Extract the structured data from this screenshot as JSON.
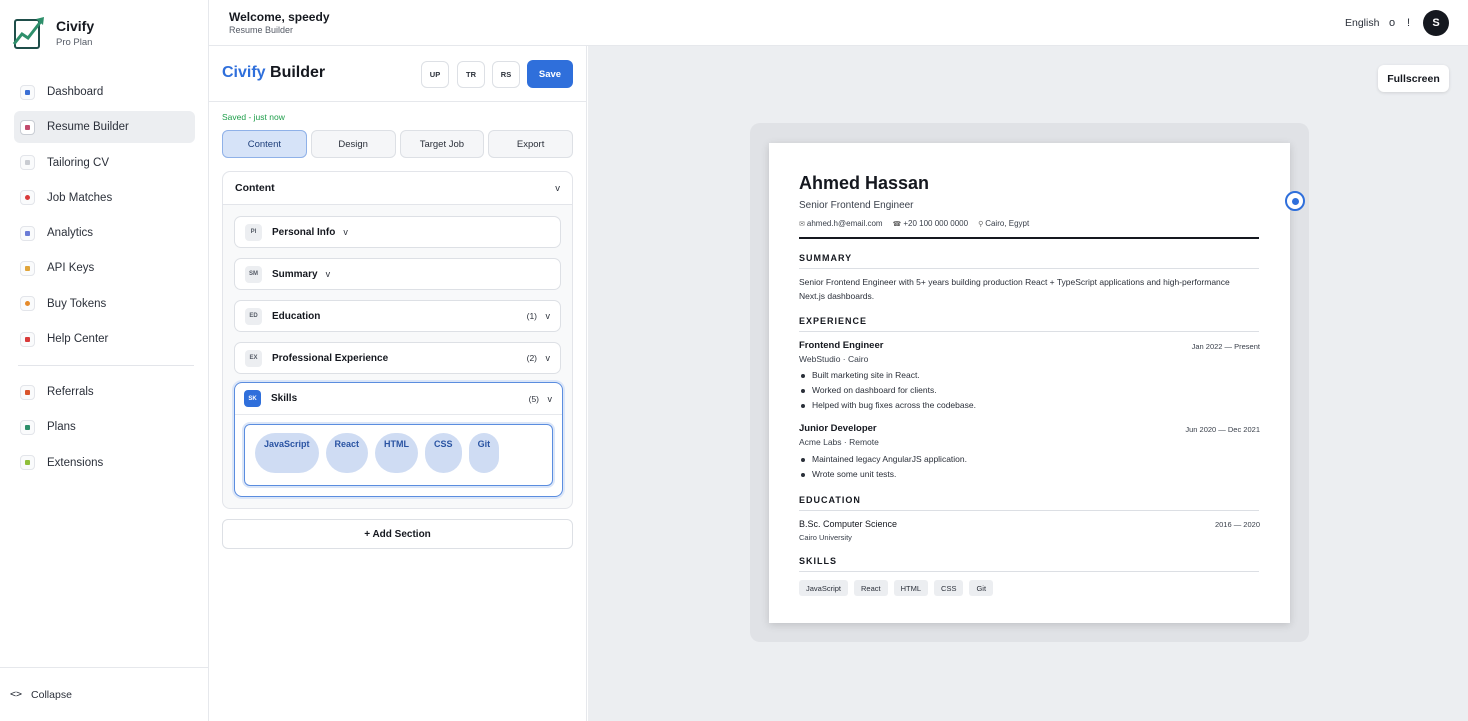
{
  "brand": {
    "name": "Civify",
    "plan": "Pro Plan"
  },
  "nav": {
    "items": [
      {
        "label": "Dashboard",
        "icon": "dashboard-icon",
        "color": "#3b6fd4"
      },
      {
        "label": "Resume Builder",
        "icon": "pencil-icon",
        "color": "#c24b6d"
      },
      {
        "label": "Tailoring CV",
        "icon": "document-icon",
        "color": "#c9ccd2"
      },
      {
        "label": "Job Matches",
        "icon": "target-icon",
        "color": "#d93a3a"
      },
      {
        "label": "Analytics",
        "icon": "chart-icon",
        "color": "#6b7cd6"
      },
      {
        "label": "API Keys",
        "icon": "key-icon",
        "color": "#e0a43a"
      },
      {
        "label": "Buy Tokens",
        "icon": "coin-icon",
        "color": "#e58a2a"
      },
      {
        "label": "Help Center",
        "icon": "question-icon",
        "color": "#d93a3a"
      }
    ],
    "secondary": [
      {
        "label": "Referrals",
        "icon": "gift-icon",
        "color": "#d9542b"
      },
      {
        "label": "Plans",
        "icon": "card-icon",
        "color": "#2e8f6b"
      },
      {
        "label": "Extensions",
        "icon": "puzzle-icon",
        "color": "#8fbf3a"
      }
    ],
    "collapse": "Collapse",
    "collapse_arrows": "<>"
  },
  "topbar": {
    "welcome": "Welcome, speedy",
    "subtitle": "Resume Builder",
    "language": "English",
    "icon_a": "o",
    "icon_b": "!",
    "avatar": "S"
  },
  "builder": {
    "title_accent": "Civify",
    "title_rest": " Builder",
    "buttons": {
      "up": "UP",
      "tr": "TR",
      "rs": "RS",
      "save": "Save"
    },
    "saved_status": "Saved - just now",
    "tabs": [
      "Content",
      "Design",
      "Target Job",
      "Export"
    ],
    "content_header": "Content",
    "chevron": "v",
    "sections": [
      {
        "badge": "PI",
        "title": "Personal Info",
        "count": ""
      },
      {
        "badge": "SM",
        "title": "Summary",
        "count": ""
      },
      {
        "badge": "ED",
        "title": "Education",
        "count": "(1)"
      },
      {
        "badge": "EX",
        "title": "Professional Experience",
        "count": "(2)"
      }
    ],
    "skills_section": {
      "badge": "SK",
      "title": "Skills",
      "count": "(5)"
    },
    "skills": [
      "JavaScript",
      "React",
      "HTML",
      "CSS",
      "Git"
    ],
    "add_section": "+ Add Section"
  },
  "preview": {
    "fullscreen": "Fullscreen",
    "name": "Ahmed Hassan",
    "role": "Senior Frontend Engineer",
    "email": "ahmed.h@email.com",
    "phone": "+20 100 000 0000",
    "location": "Cairo, Egypt",
    "summary_title": "SUMMARY",
    "summary": "Senior Frontend Engineer with 5+ years building production React + TypeScript applications and high-performance Next.js dashboards.",
    "experience_title": "EXPERIENCE",
    "jobs": [
      {
        "title": "Frontend Engineer",
        "company": "WebStudio · Cairo",
        "dates": "Jan 2022 — Present",
        "bullets": [
          "Built marketing site in React.",
          "Worked on dashboard for clients.",
          "Helped with bug fixes across the codebase."
        ]
      },
      {
        "title": "Junior Developer",
        "company": "Acme Labs · Remote",
        "dates": "Jun 2020 — Dec 2021",
        "bullets": [
          "Maintained legacy AngularJS application.",
          "Wrote some unit tests."
        ]
      }
    ],
    "education_title": "EDUCATION",
    "degree": "B.Sc. Computer Science",
    "school": "Cairo University",
    "edu_dates": "2016 — 2020",
    "skills_title": "SKILLS",
    "skills": [
      "JavaScript",
      "React",
      "HTML",
      "CSS",
      "Git"
    ]
  },
  "colors": {
    "accent": "#2f6fdb",
    "saved": "#1e9e4a"
  }
}
